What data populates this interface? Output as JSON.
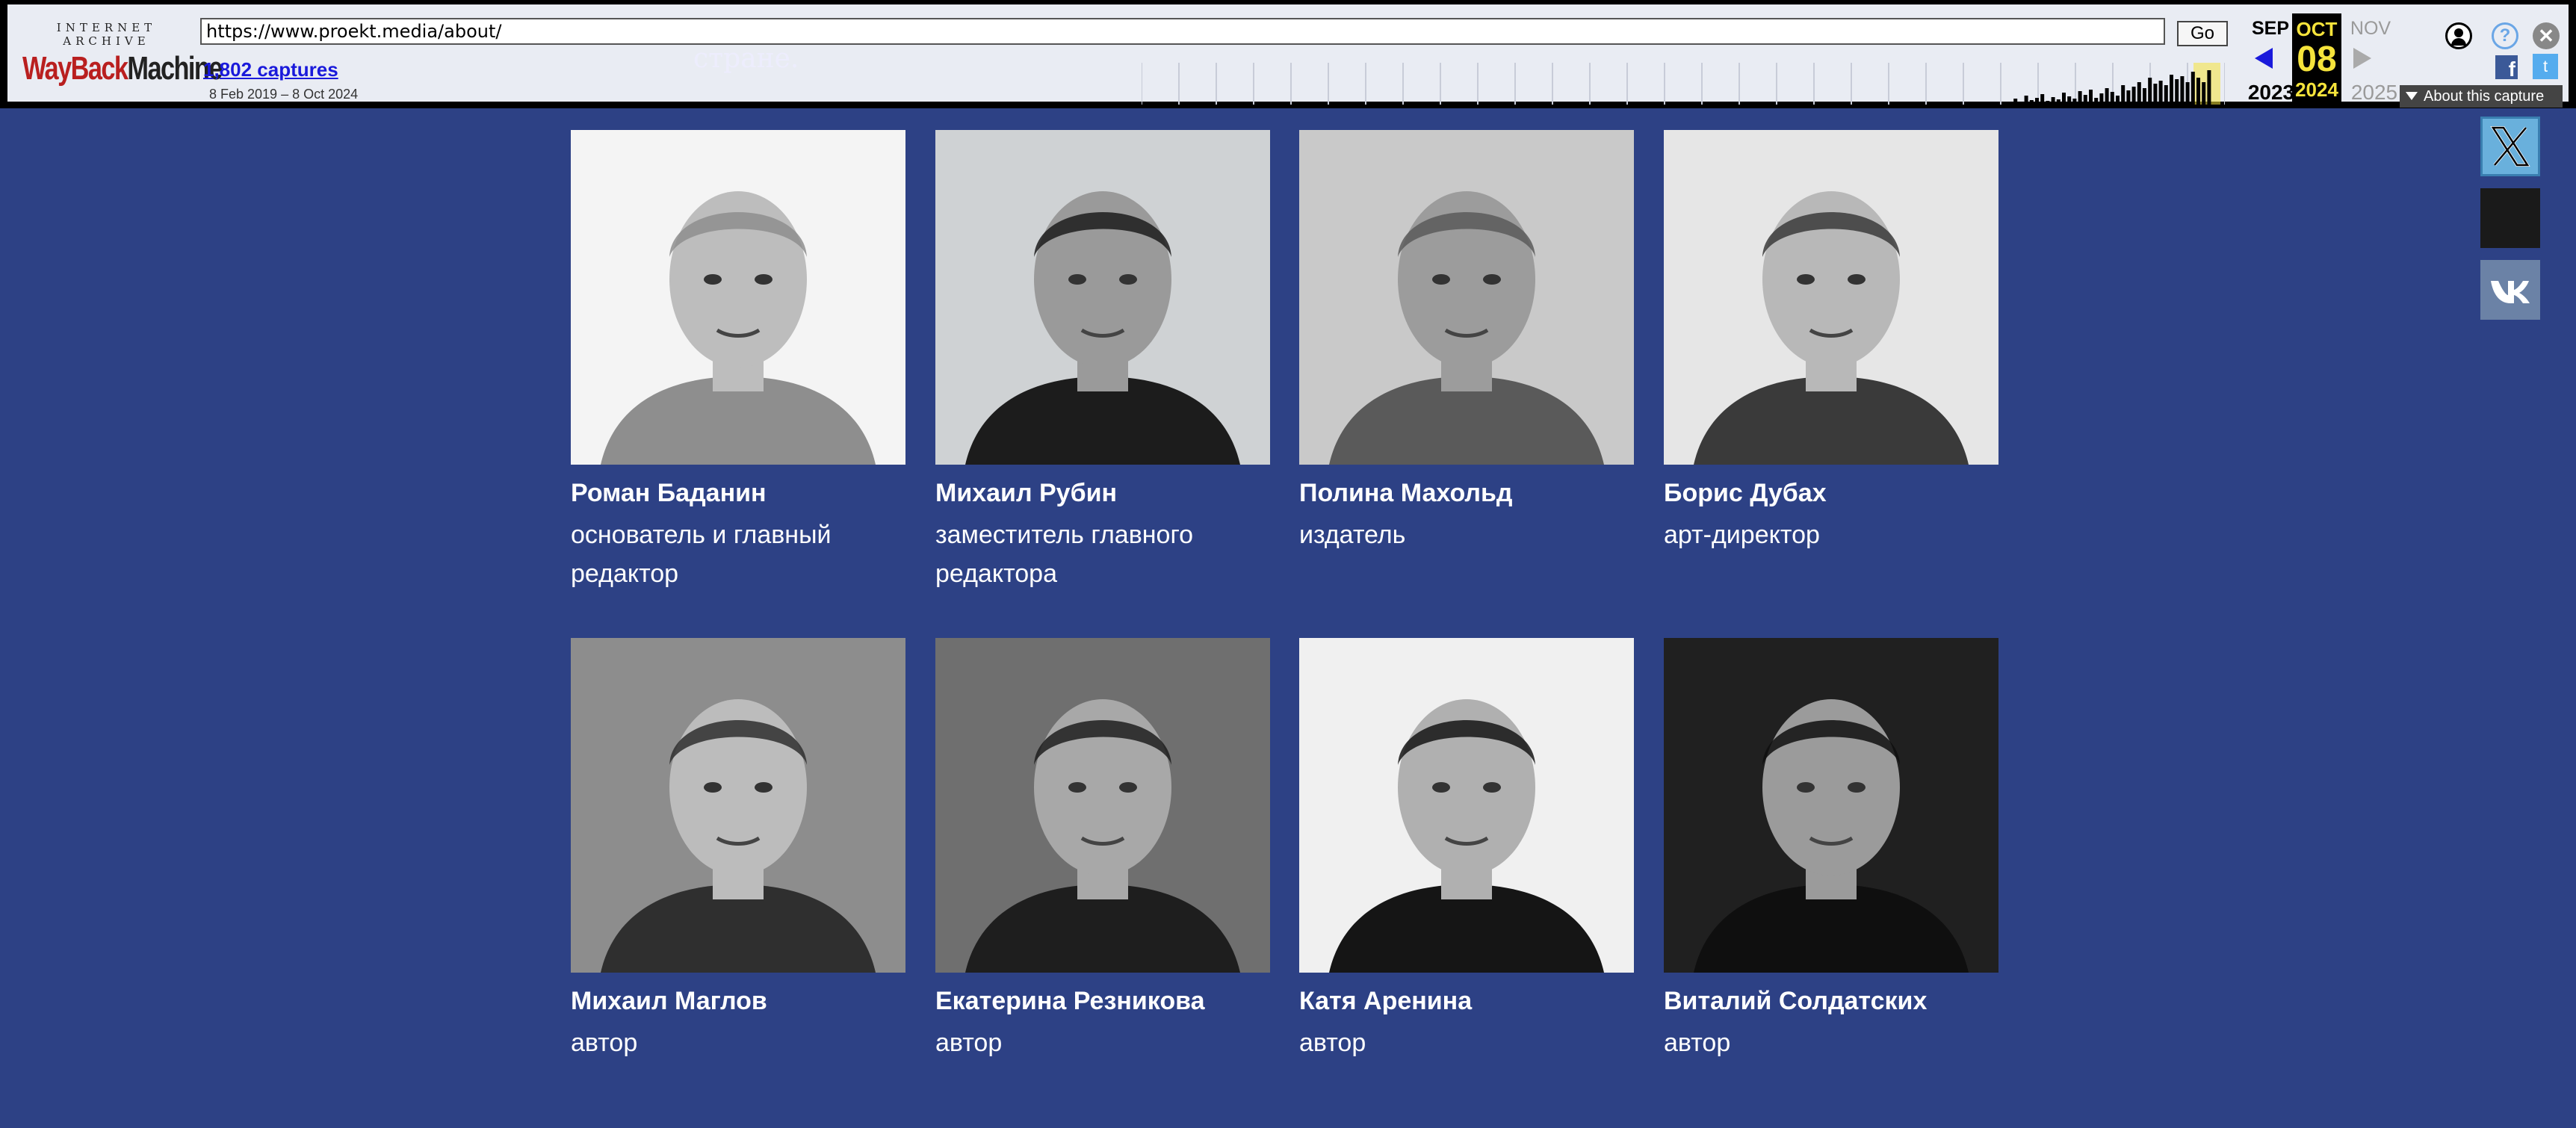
{
  "wayback": {
    "logo_top": "INTERNET ARCHIVE",
    "logo_way": "WayBack",
    "logo_machine": "Machine",
    "url": "https://www.proekt.media/about/",
    "go_label": "Go",
    "captures": "1,802 captures",
    "range": "8 Feb 2019 – 8 Oct 2024",
    "prev_month": "SEP",
    "prev_year": "2023",
    "cur_month": "OCT",
    "cur_day": "08",
    "cur_year": "2024",
    "next_month": "NOV",
    "next_year": "2025",
    "about_label": "About this capture",
    "help_glyph": "?",
    "close_glyph": "✕",
    "fb_glyph": "f",
    "tw_glyph": "t"
  },
  "peek_text": "стране.",
  "team": [
    {
      "name": "Роман Баданин",
      "role_line1": "основатель и главный",
      "role_line2": "редактор"
    },
    {
      "name": "Михаил Рубин",
      "role_line1": "заместитель главного",
      "role_line2": "редактора"
    },
    {
      "name": "Полина Махольд",
      "role_line1": "издатель",
      "role_line2": ""
    },
    {
      "name": "Борис Дубах",
      "role_line1": "арт-директор",
      "role_line2": ""
    },
    {
      "name": "Михаил Маглов",
      "role_line1": "автор",
      "role_line2": ""
    },
    {
      "name": "Екатерина Резникова",
      "role_line1": "автор",
      "role_line2": ""
    },
    {
      "name": "Катя Аренина",
      "role_line1": "автор",
      "role_line2": ""
    },
    {
      "name": "Виталий Солдатских",
      "role_line1": "автор",
      "role_line2": ""
    }
  ],
  "social": {
    "x_glyph": "𝕏",
    "vk_glyph": "VK"
  },
  "colors": {
    "page_bg": "#2d4185",
    "toolbar_bg": "#e9ecf3",
    "calendar_highlight": "#f5e33b"
  }
}
